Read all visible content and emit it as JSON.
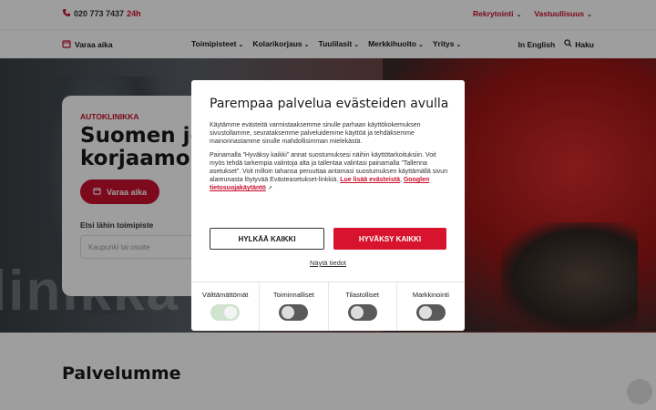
{
  "header": {
    "phone_number": "020 773 7437",
    "phone_suffix": "24h",
    "top_links": [
      "Rekrytointi",
      "Vastuullisuus"
    ]
  },
  "nav": {
    "book_label": "Varaa aika",
    "items": [
      "Toimipisteet",
      "Kolarikorjaus",
      "Tuulilasit",
      "Merkkihuolto",
      "Yritys"
    ],
    "english_label": "In English",
    "search_label": "Haku"
  },
  "hero": {
    "kicker": "AUTOKLINIKKA",
    "title": "Suomen jo\nkorjaamok",
    "cta_label": "Varaa aika",
    "find_label": "Etsi lähin toimipiste",
    "search_placeholder": "Kaupunki tai osoite",
    "background_text": "linikka"
  },
  "services": {
    "title": "Palvelumme"
  },
  "cookie_modal": {
    "title": "Parempaa palvelua evästeiden avulla",
    "paragraph1": "Käytämme evästeitä varmistaaksemme sinulle parhaan käyttökokemuksen sivustollamme, seurataksemme palveluidemme käyttöä ja tehdäksemme mainonnastamme sinulle mahdollisimman mielekästä.",
    "paragraph2": "Painamalla ”Hyväksy kaikki” annat suostumuksesi näihin käyttötarkoituksiin. Voit myös tehdä tarkempia valintoja alta ja tallentaa valintasi painamalla ”Tallenna asetukset”. Voit milloin tahansa peruuttaa antamasi suostumuksen käyttämällä sivun alareunasta löytyvää Evästeasetukset-linkkiä.",
    "link_more": "Lue lisää evästeistä",
    "link_privacy": "Googlen tietosuojakäytäntö",
    "reject_label": "HYLKÄÄ KAIKKI",
    "accept_label": "HYVÄKSY KAIKKI",
    "details_label": "Näytä tiedot",
    "toggles": [
      {
        "label": "Välttämättömät",
        "on": true
      },
      {
        "label": "Toiminnalliset",
        "on": false
      },
      {
        "label": "Tilastolliset",
        "on": false
      },
      {
        "label": "Markkinointi",
        "on": false
      }
    ]
  },
  "colors": {
    "brand_red": "#c8102e",
    "accept_red": "#d7132d"
  }
}
